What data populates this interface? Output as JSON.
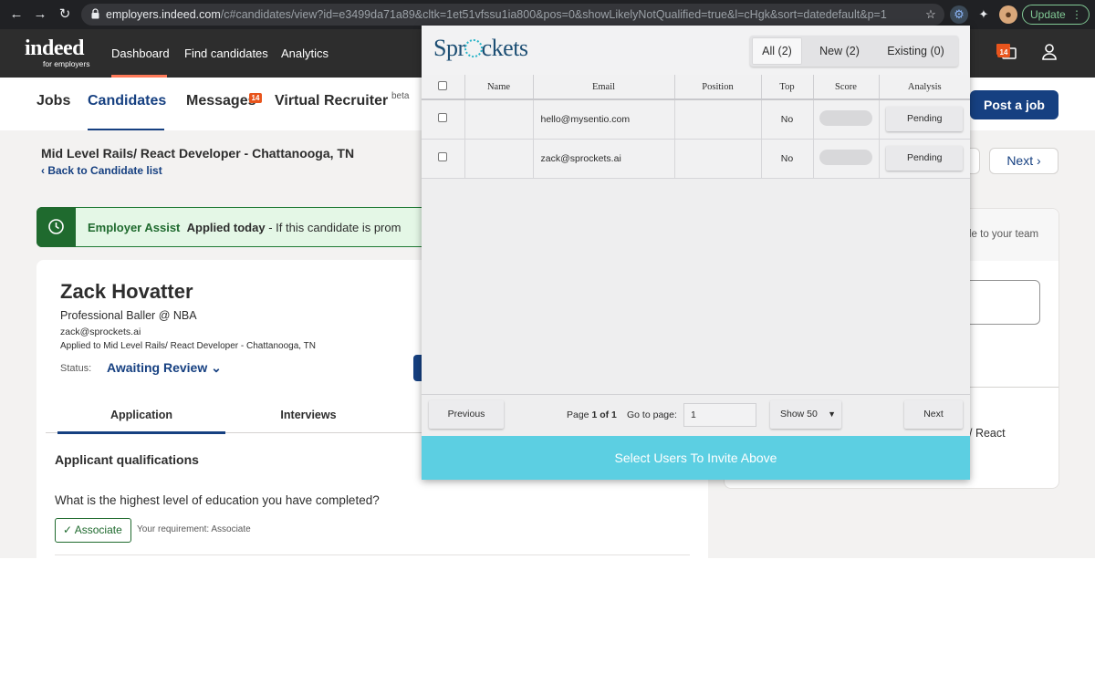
{
  "browser": {
    "url_host": "employers.indeed.com",
    "url_path": "/c#candidates/view?id=e3499da71a89&cltk=1et51vfssu1ia800&pos=0&showLikelyNotQualified=true&l=cHgk&sort=datedefault&p=1",
    "update_label": "Update"
  },
  "topnav": {
    "logo": "indeed",
    "logo_sub": "for employers",
    "items": [
      {
        "label": "Dashboard"
      },
      {
        "label": "Find candidates"
      },
      {
        "label": "Analytics"
      }
    ],
    "notif_badge": "14"
  },
  "subnav": {
    "jobs": "Jobs",
    "candidates": "Candidates",
    "messages": "Messages",
    "messages_badge": "14",
    "virtual_recruiter": "Virtual Recruiter",
    "beta": "beta",
    "post_job": "Post a job"
  },
  "job": {
    "title": "Mid Level Rails/ React Developer - Chattanooga, TN",
    "back": "Back to Candidate list",
    "next": "Next"
  },
  "assist": {
    "brand": "Employer Assist",
    "strong": "Applied today",
    "rest": "- If this candidate is prom"
  },
  "candidate": {
    "name": "Zack Hovatter",
    "headline": "Professional Baller @ NBA",
    "email": "zack@sprockets.ai",
    "applied": "Applied to Mid Level Rails/ React Developer - Chattanooga, TN",
    "status_label": "Status:",
    "status_value": "Awaiting Review"
  },
  "tabs": [
    {
      "label": "Application"
    },
    {
      "label": "Interviews"
    }
  ],
  "qualifications": {
    "title": "Applicant qualifications",
    "question": "What is the highest level of education you have completed?",
    "answer": "Associate",
    "requirement": "Your requirement: Associate"
  },
  "right_card": {
    "team_text": "le to your team",
    "react_text": "/ React"
  },
  "sprockets": {
    "logo_pre": "Spr",
    "logo_post": "ckets",
    "segments": [
      {
        "label": "All (2)"
      },
      {
        "label": "New (2)"
      },
      {
        "label": "Existing (0)"
      }
    ],
    "columns": [
      "Name",
      "Email",
      "Position",
      "Top",
      "Score",
      "Analysis"
    ],
    "rows": [
      {
        "name": "",
        "email": "hello@mysentio.com",
        "position": "",
        "top": "No",
        "analysis": "Pending"
      },
      {
        "name": "",
        "email": "zack@sprockets.ai",
        "position": "",
        "top": "No",
        "analysis": "Pending"
      }
    ],
    "previous": "Previous",
    "page_prefix": "Page",
    "page_current": "1 of 1",
    "goto_label": "Go to page:",
    "goto_value": "1",
    "show": "Show 50",
    "next": "Next",
    "invite": "Select Users To Invite Above",
    "invite_color": "#5ccfe2"
  }
}
